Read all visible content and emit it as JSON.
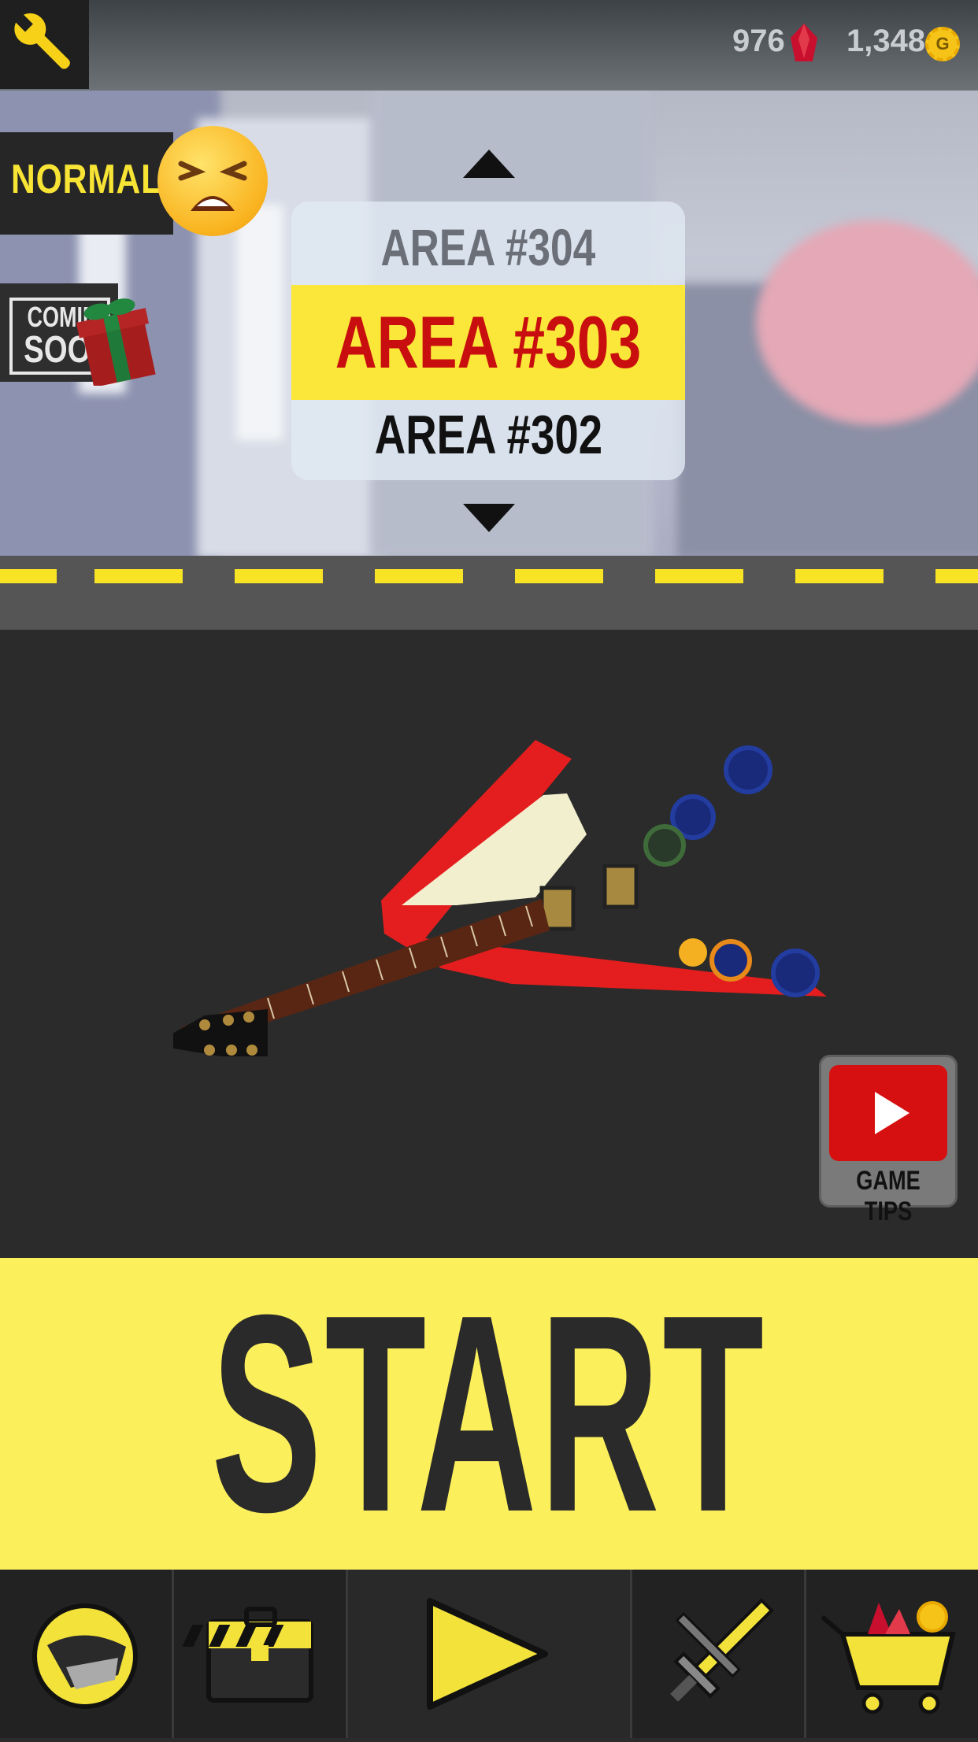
{
  "header": {
    "gems": "976",
    "coins": "1,348",
    "gem_color": "#c8102e",
    "coin_color": "#f6c418",
    "coin_glyph": "G"
  },
  "difficulty": {
    "label": "NORMAL",
    "icon": "tired-face-emoji-icon"
  },
  "promo": {
    "line1": "COMING",
    "line2": "SOON",
    "icon": "gift-icon"
  },
  "area_picker": {
    "above": "AREA #304",
    "selected": "AREA #303",
    "below": "AREA #302",
    "selected_color": "#c80e0e",
    "highlight_color": "#fbe739"
  },
  "guitar": {
    "icon": "flying-v-guitar-icon",
    "body_color": "#e41e1e"
  },
  "game_tips": {
    "label": "GAME TIPS",
    "icon": "video-play-icon"
  },
  "start": {
    "label": "START",
    "bg": "#fcef5c"
  },
  "nav": [
    {
      "name": "helmet",
      "icon": "helmet-icon"
    },
    {
      "name": "toolbox",
      "icon": "toolbox-icon"
    },
    {
      "name": "play",
      "icon": "play-icon"
    },
    {
      "name": "sword",
      "icon": "sword-icon"
    },
    {
      "name": "shop",
      "icon": "shopping-cart-icon"
    }
  ]
}
